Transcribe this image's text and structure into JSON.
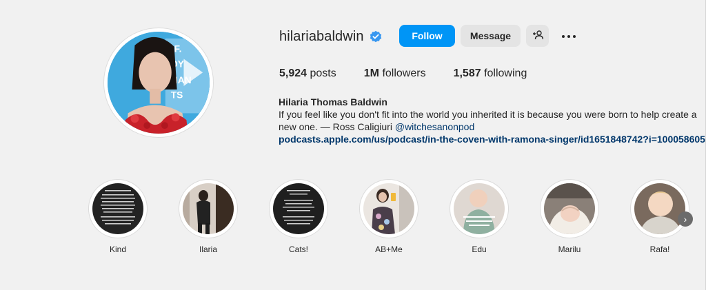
{
  "profile": {
    "username": "hilariabaldwin",
    "verified_icon": "verified-badge-icon",
    "accent_color": "#0095f6",
    "follow_label": "Follow",
    "message_label": "Message",
    "add_user_icon": "add-user-icon",
    "more_icon": "more-options-icon"
  },
  "stats": {
    "posts_count": "5,924",
    "posts_label": "posts",
    "followers_count": "1M",
    "followers_label": "followers",
    "following_count": "1,587",
    "following_label": "following"
  },
  "bio": {
    "full_name": "Hilaria Thomas Baldwin",
    "text": "If you feel like you don't fit into the world you inherited it is because you were born to help create a new one. — Ross Caligiuri ",
    "mention": "@witchesanonpod",
    "link": "podcasts.apple.com/us/podcast/in-the-coven-with-ramona-singer/id1651848742?i=100058605..."
  },
  "highlights": [
    {
      "label": "Kind"
    },
    {
      "label": "Ilaria"
    },
    {
      "label": "Cats!"
    },
    {
      "label": "AB+Me"
    },
    {
      "label": "Edu"
    },
    {
      "label": "Marilu"
    },
    {
      "label": "Rafa!"
    }
  ],
  "next_icon": "chevron-right-icon"
}
